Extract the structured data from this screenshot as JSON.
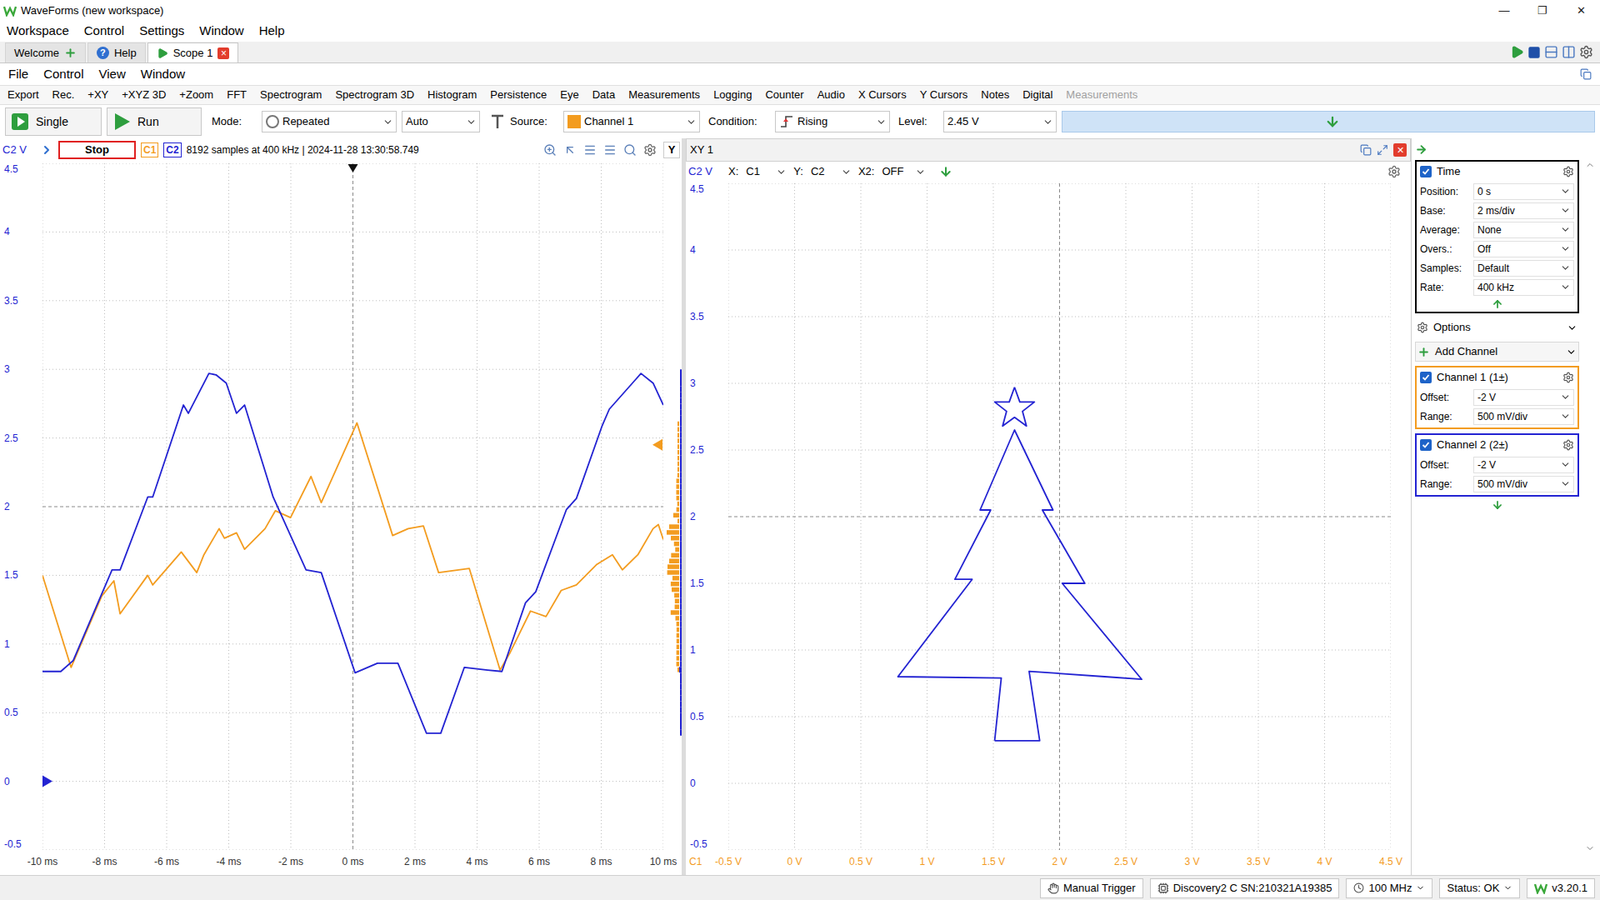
{
  "window": {
    "title": "WaveForms (new workspace)",
    "controls": [
      "—",
      "❐",
      "✕"
    ]
  },
  "app_menu": [
    "Workspace",
    "Control",
    "Settings",
    "Window",
    "Help"
  ],
  "workspace_tabs": [
    {
      "label": "Welcome",
      "kind": "welcome",
      "selected": false
    },
    {
      "label": "Help",
      "kind": "help",
      "glyph": "?",
      "selected": false
    },
    {
      "label": "Scope 1",
      "kind": "scope",
      "close": "×",
      "selected": true
    }
  ],
  "instrument_menu": [
    "File",
    "Control",
    "View",
    "Window"
  ],
  "toolbar": [
    {
      "label": "Export",
      "disabled": false
    },
    {
      "label": "Rec.",
      "disabled": false
    },
    {
      "label": "+XY",
      "disabled": false
    },
    {
      "label": "+XYZ 3D",
      "disabled": false
    },
    {
      "label": "+Zoom",
      "disabled": false
    },
    {
      "label": "FFT",
      "disabled": false
    },
    {
      "label": "Spectrogram",
      "disabled": false
    },
    {
      "label": "Spectrogram 3D",
      "disabled": false
    },
    {
      "label": "Histogram",
      "disabled": false
    },
    {
      "label": "Persistence",
      "disabled": false
    },
    {
      "label": "Eye",
      "disabled": false
    },
    {
      "label": "Data",
      "disabled": false
    },
    {
      "label": "Measurements",
      "disabled": false
    },
    {
      "label": "Logging",
      "disabled": false
    },
    {
      "label": "Counter",
      "disabled": false
    },
    {
      "label": "Audio",
      "disabled": false
    },
    {
      "label": "X Cursors",
      "disabled": false
    },
    {
      "label": "Y Cursors",
      "disabled": false
    },
    {
      "label": "Notes",
      "disabled": false
    },
    {
      "label": "Digital",
      "disabled": false
    },
    {
      "label": "Measurements",
      "disabled": true
    }
  ],
  "trigger": {
    "single": "Single",
    "run": "Run",
    "mode_label": "Mode:",
    "mode": "Repeated",
    "auto": "Auto",
    "source_label": "Source:",
    "source": "Channel 1",
    "source_color": "#f39c1f",
    "condition_label": "Condition:",
    "condition": "Rising",
    "level_label": "Level:",
    "level": "2.45 V"
  },
  "scope": {
    "y_unit_label": "C2 V",
    "state": "Stop",
    "channel_tags": [
      {
        "label": "C1",
        "color": "#f39c1f"
      },
      {
        "label": "C2",
        "color": "#2323d2"
      }
    ],
    "info": "8192 samples at 400 kHz | 2024-11-28 13:30:58.749",
    "y_button": "Y",
    "y_ticks": [
      "4.5",
      "4",
      "3.5",
      "3",
      "2.5",
      "2",
      "1.5",
      "1",
      "0.5",
      "0",
      "-0.5"
    ],
    "x_ticks": [
      "-10 ms",
      "-8 ms",
      "-6 ms",
      "-4 ms",
      "-2 ms",
      "0 ms",
      "2 ms",
      "4 ms",
      "6 ms",
      "8 ms",
      "10 ms"
    ],
    "x_range_ms": [
      -10,
      10
    ],
    "y_range": [
      -0.5,
      4.5
    ],
    "trigger_level": 2.45,
    "trigger_position_ms": 0,
    "c2_marker_v": 0,
    "series": [
      {
        "name": "C1",
        "color": "#f39c1f",
        "t_ms": [
          -10.0,
          -9.08,
          -8.09,
          -7.7,
          -7.5,
          -6.61,
          -6.45,
          -5.53,
          -5.03,
          -4.8,
          -4.31,
          -4.14,
          -3.75,
          -3.49,
          -2.83,
          -2.5,
          -2.01,
          -1.35,
          -1.02,
          0.13,
          1.28,
          1.78,
          2.27,
          2.76,
          3.75,
          4.74,
          5.07,
          5.72,
          6.22,
          6.71,
          7.2,
          7.86,
          8.36,
          8.68,
          9.18,
          9.67,
          9.84,
          10.0
        ],
        "v": [
          1.5,
          0.83,
          1.35,
          1.46,
          1.22,
          1.5,
          1.43,
          1.67,
          1.52,
          1.65,
          1.84,
          1.77,
          1.81,
          1.69,
          1.84,
          1.97,
          1.92,
          2.22,
          2.03,
          2.61,
          1.79,
          1.84,
          1.86,
          1.52,
          1.55,
          0.81,
          0.94,
          1.24,
          1.2,
          1.39,
          1.43,
          1.58,
          1.65,
          1.54,
          1.65,
          1.84,
          1.87,
          1.76
        ]
      },
      {
        "name": "C2",
        "color": "#2323d2",
        "t_ms": [
          -10.0,
          -9.41,
          -9.01,
          -7.76,
          -7.5,
          -6.61,
          -6.45,
          -5.46,
          -5.3,
          -4.64,
          -4.41,
          -4.08,
          -3.75,
          -3.49,
          -2.57,
          -1.51,
          -1.02,
          0.07,
          0.79,
          1.45,
          2.37,
          2.83,
          3.59,
          4.34,
          4.8,
          5.56,
          5.89,
          6.88,
          7.2,
          8.03,
          8.26,
          9.28,
          9.67,
          10.0
        ],
        "v": [
          0.8,
          0.8,
          0.88,
          1.54,
          1.54,
          2.07,
          2.07,
          2.74,
          2.68,
          2.97,
          2.96,
          2.9,
          2.68,
          2.74,
          2.07,
          1.54,
          1.52,
          0.79,
          0.86,
          0.86,
          0.35,
          0.35,
          0.83,
          0.81,
          0.8,
          1.3,
          1.38,
          1.98,
          2.06,
          2.59,
          2.71,
          2.97,
          2.9,
          2.74
        ]
      }
    ]
  },
  "xy": {
    "title": "XY 1",
    "close": "✕",
    "x_label": "X:",
    "x": "C1",
    "y_label": "Y:",
    "y": "C2",
    "x2_label": "X2:",
    "x2": "OFF",
    "y_axis_label": "C2 V",
    "x_axis_label": "C1",
    "x_color": "#f39c1f",
    "y_color": "#2323d2",
    "y_ticks": [
      "4.5",
      "4",
      "3.5",
      "3",
      "2.5",
      "2",
      "1.5",
      "1",
      "0.5",
      "0",
      "-0.5"
    ],
    "x_ticks": [
      "-0.5 V",
      "0 V",
      "0.5 V",
      "1 V",
      "1.5 V",
      "2 V",
      "2.5 V",
      "3 V",
      "3.5 V",
      "4 V",
      "4.5 V"
    ],
    "x_range": [
      -0.5,
      4.5
    ],
    "y_range": [
      -0.5,
      4.5
    ],
    "traces": [
      {
        "c1": [
          1.51,
          1.85,
          1.77,
          2.34,
          2.62,
          2.02,
          2.19,
          1.87,
          1.95,
          1.66,
          1.4,
          1.48,
          1.21,
          1.34,
          0.78,
          1.56,
          1.51
        ],
        "c2": [
          0.32,
          0.32,
          0.84,
          0.8,
          0.78,
          1.5,
          1.5,
          2.05,
          2.05,
          2.65,
          2.05,
          2.05,
          1.53,
          1.53,
          0.8,
          0.79,
          0.32
        ]
      },
      {
        "c1": [
          1.66,
          1.7,
          1.81,
          1.72,
          1.75,
          1.66,
          1.57,
          1.6,
          1.51,
          1.62,
          1.66
        ],
        "c2": [
          2.97,
          2.86,
          2.86,
          2.79,
          2.68,
          2.745,
          2.68,
          2.79,
          2.86,
          2.86,
          2.97
        ]
      }
    ]
  },
  "side_panel": {
    "time": {
      "label": "Time",
      "checked": true,
      "fields": [
        {
          "label": "Position:",
          "value": "0 s"
        },
        {
          "label": "Base:",
          "value": "2 ms/div"
        },
        {
          "label": "Average:",
          "value": "None"
        },
        {
          "label": "Overs.:",
          "value": "Off"
        },
        {
          "label": "Samples:",
          "value": "Default"
        },
        {
          "label": "Rate:",
          "value": "400 kHz"
        }
      ]
    },
    "options": "Options",
    "add_channel": "Add Channel",
    "channels": [
      {
        "label": "Channel 1 (1±)",
        "checked": true,
        "color": "#f39c1f",
        "fields": [
          {
            "label": "Offset:",
            "value": "-2 V"
          },
          {
            "label": "Range:",
            "value": "500 mV/div"
          }
        ]
      },
      {
        "label": "Channel 2 (2±)",
        "checked": true,
        "color": "#2323d2",
        "fields": [
          {
            "label": "Offset:",
            "value": "-2 V"
          },
          {
            "label": "Range:",
            "value": "500 mV/div"
          }
        ]
      }
    ]
  },
  "status_bar": [
    {
      "label": "Manual Trigger",
      "kind": "trigger"
    },
    {
      "label": "Discovery2 C SN:210321A19385",
      "kind": "device"
    },
    {
      "label": "100 MHz",
      "kind": "clock"
    },
    {
      "label": "Status: OK",
      "kind": "status"
    },
    {
      "label": "v3.20.1",
      "kind": "version"
    }
  ]
}
